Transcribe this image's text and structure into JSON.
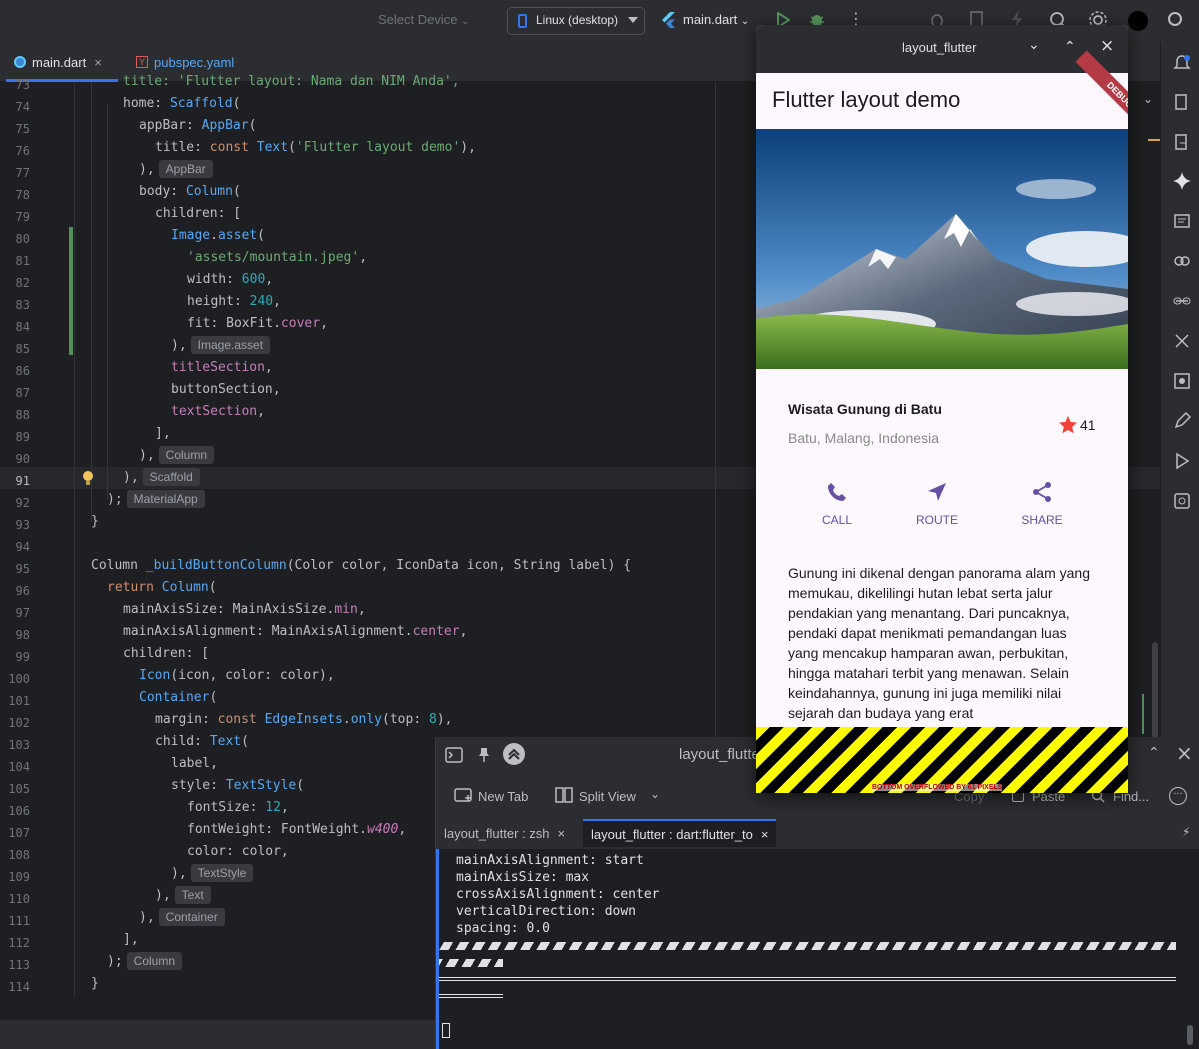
{
  "toolbar": {
    "select_device": "Select Device",
    "device": "Linux (desktop)",
    "run_config": "main.dart"
  },
  "tabs": [
    {
      "label": "main.dart"
    },
    {
      "label": "pubspec.yaml"
    }
  ],
  "editor": {
    "lines": [
      {
        "n": "74",
        "html": "<span class=\"kw\">home</span>: <span class=\"fn\">Scaffold</span>("
      },
      {
        "n": "75",
        "text": "appBar"
      },
      {
        "n": "76"
      },
      {
        "n": "77"
      },
      {
        "n": "78"
      },
      {
        "n": "79"
      },
      {
        "n": "80"
      },
      {
        "n": "81"
      },
      {
        "n": "82"
      },
      {
        "n": "83"
      },
      {
        "n": "84"
      },
      {
        "n": "85"
      },
      {
        "n": "86"
      },
      {
        "n": "87"
      },
      {
        "n": "88"
      },
      {
        "n": "89"
      },
      {
        "n": "90"
      },
      {
        "n": "91"
      },
      {
        "n": "92"
      },
      {
        "n": "93"
      },
      {
        "n": "94"
      },
      {
        "n": "95"
      },
      {
        "n": "96"
      },
      {
        "n": "97"
      },
      {
        "n": "98"
      },
      {
        "n": "99"
      },
      {
        "n": "100"
      },
      {
        "n": "101"
      },
      {
        "n": "102"
      },
      {
        "n": "103"
      },
      {
        "n": "104"
      },
      {
        "n": "105"
      },
      {
        "n": "106"
      },
      {
        "n": "107"
      },
      {
        "n": "108"
      },
      {
        "n": "109"
      },
      {
        "n": "110"
      },
      {
        "n": "111"
      },
      {
        "n": "112"
      },
      {
        "n": "113"
      },
      {
        "n": "114"
      }
    ],
    "code": {
      "l73": "title: 'Flutter layout: Nama dan NIM Anda',",
      "l74a": "home: ",
      "l74b": "Scaffold",
      "l74c": "(",
      "l75a": "appBar: ",
      "l75b": "AppBar",
      "l75c": "(",
      "l76a": "title: ",
      "l76b": "const ",
      "l76c": "Text",
      "l76d": "(",
      "l76e": "'Flutter layout demo'",
      "l76f": "),",
      "l77a": "),",
      "l77hint": "AppBar",
      "l78a": "body: ",
      "l78b": "Column",
      "l78c": "(",
      "l79": "children: [",
      "l80a": "Image",
      "l80b": ".",
      "l80c": "asset",
      "l80d": "(",
      "l81": "'assets/mountain.jpeg'",
      "l81b": ",",
      "l82a": "width: ",
      "l82b": "600",
      "l82c": ",",
      "l83a": "height: ",
      "l83b": "240",
      "l83c": ",",
      "l84a": "fit: BoxFit.",
      "l84b": "cover",
      "l84c": ",",
      "l85a": "),",
      "l85hint": "Image.asset",
      "l86": "titleSection",
      "l86b": ",",
      "l87": "buttonSection,",
      "l88": "textSection",
      "l88b": ",",
      "l89": "],",
      "l90a": "),",
      "l90hint": "Column",
      "l91a": "),",
      "l91hint": "Scaffold",
      "l92a": ");",
      "l92hint": "MaterialApp",
      "l93": "}",
      "l95a": "Column ",
      "l95b": "_buildButtonColumn",
      "l95c": "(Color color, IconData icon, String label) {",
      "l96a": "return ",
      "l96b": "Column",
      "l96c": "(",
      "l97a": "mainAxisSize: MainAxisSize.",
      "l97b": "min",
      "l97c": ",",
      "l98a": "mainAxisAlignment: MainAxisAlignment.",
      "l98b": "center",
      "l98c": ",",
      "l99": "children: [",
      "l100a": "Icon",
      "l100b": "(icon, color: color),",
      "l101a": "Container",
      "l101b": "(",
      "l102a": "margin: ",
      "l102b": "const ",
      "l102c": "EdgeInsets",
      "l102d": ".",
      "l102e": "only",
      "l102f": "(top: ",
      "l102g": "8",
      "l102h": "),",
      "l103a": "child: ",
      "l103b": "Text",
      "l103c": "(",
      "l104": "label,",
      "l105a": "style: ",
      "l105b": "TextStyle",
      "l105c": "(",
      "l106a": "fontSize: ",
      "l106b": "12",
      "l106c": ",",
      "l107a": "fontWeight: FontWeight.",
      "l107b": "w400",
      "l107c": ",",
      "l108": "color: color,",
      "l109a": "),",
      "l109hint": "TextStyle",
      "l110a": "),",
      "l110hint": "Text",
      "l111a": "),",
      "l111hint": "Container",
      "l112": "],",
      "l113a": ");",
      "l113hint": "Column",
      "l114": "}"
    }
  },
  "app": {
    "window_title": "layout_flutter",
    "appbar_title": "Flutter layout demo",
    "debug_banner": "DEBUG",
    "title": "Wisata Gunung di Batu",
    "subtitle": "Batu, Malang, Indonesia",
    "rating": "41",
    "buttons": [
      {
        "label": "CALL",
        "icon": "call-icon"
      },
      {
        "label": "ROUTE",
        "icon": "navigation-icon"
      },
      {
        "label": "SHARE",
        "icon": "share-icon"
      }
    ],
    "description": "Gunung ini dikenal dengan panorama alam yang memukau, dikelilingi hutan lebat serta jalur pendakian yang menantang. Dari puncaknya, pendaki dapat menikmati pemandangan luas yang mencakup hamparan awan, perbukitan, hingga matahari terbit yang menawan. Selain keindahannya, gunung ini juga memiliki nilai sejarah dan budaya yang erat",
    "overflow_label": "BOTTOM OVERFLOWED BY 61 PIXELS",
    "accent": "#6750a4",
    "star_color": "#f44336"
  },
  "terminal": {
    "title": "layout_flutter",
    "new_tab": "New Tab",
    "split_view": "Split View",
    "copy": "Copy",
    "paste": "Paste",
    "find": "Find...",
    "tabs": [
      {
        "label": "layout_flutter : zsh"
      },
      {
        "label": "layout_flutter : dart:flutter_to"
      }
    ],
    "lines": [
      "mainAxisAlignment: start",
      "mainAxisSize: max",
      "crossAxisAlignment: center",
      "verticalDirection: down",
      "spacing: 0.0"
    ]
  }
}
